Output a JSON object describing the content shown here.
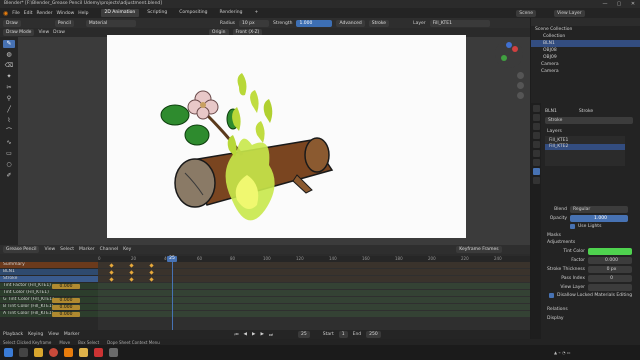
{
  "title_bar": {
    "text": "Blender* [F:\\Blender_Grease Pencil Udemy\\projects\\adjustment.blend]"
  },
  "menu": {
    "items": [
      "File",
      "Edit",
      "Render",
      "Window",
      "Help"
    ],
    "workspaces": [
      "2D Animation",
      "Scripting",
      "Compositing",
      "Rendering",
      "+"
    ],
    "active_workspace": "2D Animation",
    "scene": "Scene",
    "view_layer": "View Layer"
  },
  "tool_header": {
    "mode": "Draw",
    "brush": "Pencil",
    "material": "Material",
    "radius_label": "Radius",
    "radius": "10 px",
    "strength_label": "Strength",
    "strength": "1.000",
    "advanced": "Advanced",
    "stroke": "Stroke",
    "layer_label": "Layer",
    "layer": "Fill_KTE1"
  },
  "viewport_header": {
    "mode": "Draw Mode",
    "view": "View",
    "draw": "Draw",
    "origin": "Origin",
    "placement": "Front (X-Z)"
  },
  "outliner": {
    "items": [
      {
        "label": "Scene Collection",
        "sel": false
      },
      {
        "label": "Collection",
        "sel": false
      },
      {
        "label": "BLN1",
        "sel": true
      },
      {
        "label": "OBJ08",
        "sel": false
      },
      {
        "label": "OBJ09",
        "sel": false
      },
      {
        "label": "Camera",
        "sel": false
      },
      {
        "label": "Camera",
        "sel": false
      }
    ]
  },
  "properties": {
    "object": "BLN1",
    "data_name": "Stroke",
    "layers_header": "Layers",
    "layers": [
      "Fill_KTE1",
      "Fill_KTE2"
    ],
    "blend_label": "Blend",
    "blend": "Regular",
    "opacity_label": "Opacity",
    "opacity": "1.000",
    "use_lights": "Use Lights",
    "masks": "Masks",
    "adjustments": "Adjustments",
    "tint_color_label": "Tint Color",
    "factor_label": "Factor",
    "factor": "0.000",
    "stroke_thickness_label": "Stroke Thickness",
    "stroke_thickness": "0 px",
    "pass_index_label": "Pass Index",
    "pass_index": "0",
    "view_layer_label": "View Layer",
    "disable_edit": "Disallow Locked Materials Editing",
    "relations": "Relations",
    "display": "Display"
  },
  "dope_sheet": {
    "mode": "Grease Pencil",
    "menus": [
      "View",
      "Select",
      "Marker",
      "Channel",
      "Key"
    ],
    "filter": "Keyframe Frames",
    "ruler": [
      "0",
      "20",
      "40",
      "60",
      "80",
      "100",
      "120",
      "140",
      "160",
      "180",
      "200",
      "220",
      "240"
    ],
    "current_frame": "25",
    "channels": [
      {
        "label": "Summary",
        "value": "",
        "color": "#6b3a1c"
      },
      {
        "label": "BLN1",
        "value": "",
        "color": "#2f4a6e"
      },
      {
        "label": "Stroke",
        "value": "",
        "color": "#3a5a8c"
      },
      {
        "label": "Tint Factor (Fill_KTE1)",
        "value": "0.000",
        "color": "#2c3d2c"
      },
      {
        "label": "Tint Color (Fill_KTE1)",
        "value": "",
        "color": "#2c3d2c"
      },
      {
        "label": "G Tint Color (Fill_KTE1)",
        "value": "0.000",
        "color": "#2c3d2c"
      },
      {
        "label": "B Tint Color (Fill_KTE1)",
        "value": "0.000",
        "color": "#2c3d2c"
      },
      {
        "label": "A Tint Color (Fill_KTE1)",
        "value": "0.000",
        "color": "#2c3d2c"
      }
    ]
  },
  "playback": {
    "items": [
      "Playback",
      "Keying",
      "View",
      "Marker"
    ],
    "frame": "25",
    "start_label": "Start",
    "start": "1",
    "end_label": "End",
    "end": "250"
  },
  "statusbar": {
    "items": [
      "Select Clicked Keyframe",
      "Move",
      "Box Select",
      "Dope Sheet Context Menu"
    ]
  },
  "colors": {
    "accent": "#4772b3",
    "tint_swatch": "#4fd34f",
    "bark": "#7a4520",
    "leaf": "#2e8b2e",
    "flame": "#c8e84a"
  }
}
